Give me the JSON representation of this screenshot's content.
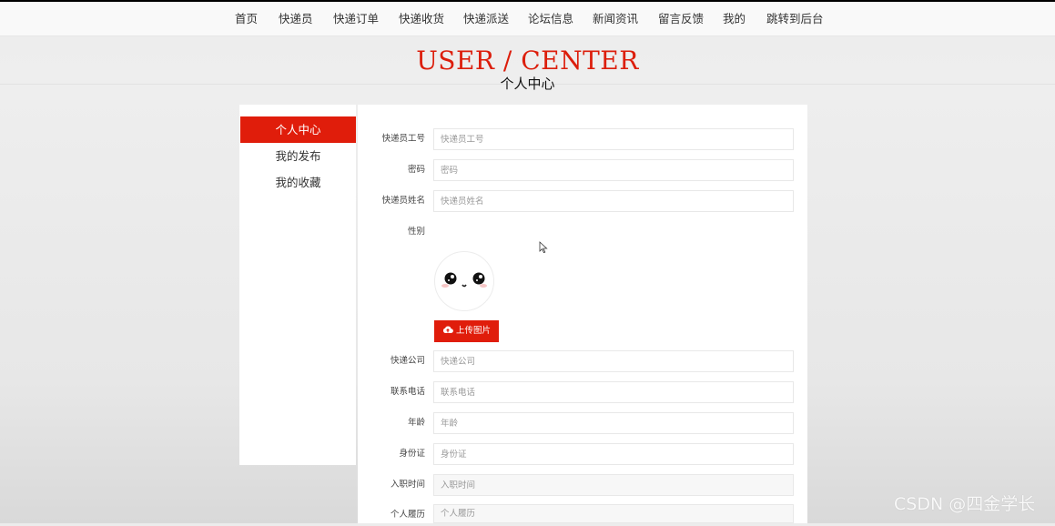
{
  "nav": {
    "items": [
      "首页",
      "快递员",
      "快递订单",
      "快递收货",
      "快递派送",
      "论坛信息",
      "新闻资讯",
      "留言反馈",
      "我的",
      "跳转到后台"
    ]
  },
  "banner": {
    "title_en": "USER / CENTER",
    "title_cn": "个人中心"
  },
  "sidebar": {
    "items": [
      {
        "label": "个人中心",
        "active": true
      },
      {
        "label": "我的发布",
        "active": false
      },
      {
        "label": "我的收藏",
        "active": false
      }
    ]
  },
  "form": {
    "courier_id": {
      "label": "快递员工号",
      "placeholder": "快递员工号"
    },
    "password": {
      "label": "密码",
      "placeholder": "密码"
    },
    "courier_name": {
      "label": "快递员姓名",
      "placeholder": "快递员姓名"
    },
    "gender": {
      "label": "性别"
    },
    "avatar_icon": "smiley-face-icon",
    "upload": {
      "icon": "cloud-upload-icon",
      "label": "上传图片"
    },
    "company": {
      "label": "快递公司",
      "placeholder": "快递公司"
    },
    "phone": {
      "label": "联系电话",
      "placeholder": "联系电话"
    },
    "age": {
      "label": "年龄",
      "placeholder": "年龄"
    },
    "id_card": {
      "label": "身份证",
      "placeholder": "身份证"
    },
    "hire_date": {
      "label": "入职时间",
      "placeholder": "入职时间"
    },
    "resume": {
      "label": "个人履历",
      "placeholder": "个人履历"
    }
  },
  "watermark": "CSDN @四金学长",
  "colors": {
    "accent": "#e01d0b",
    "title_red": "#dc1e0c"
  }
}
